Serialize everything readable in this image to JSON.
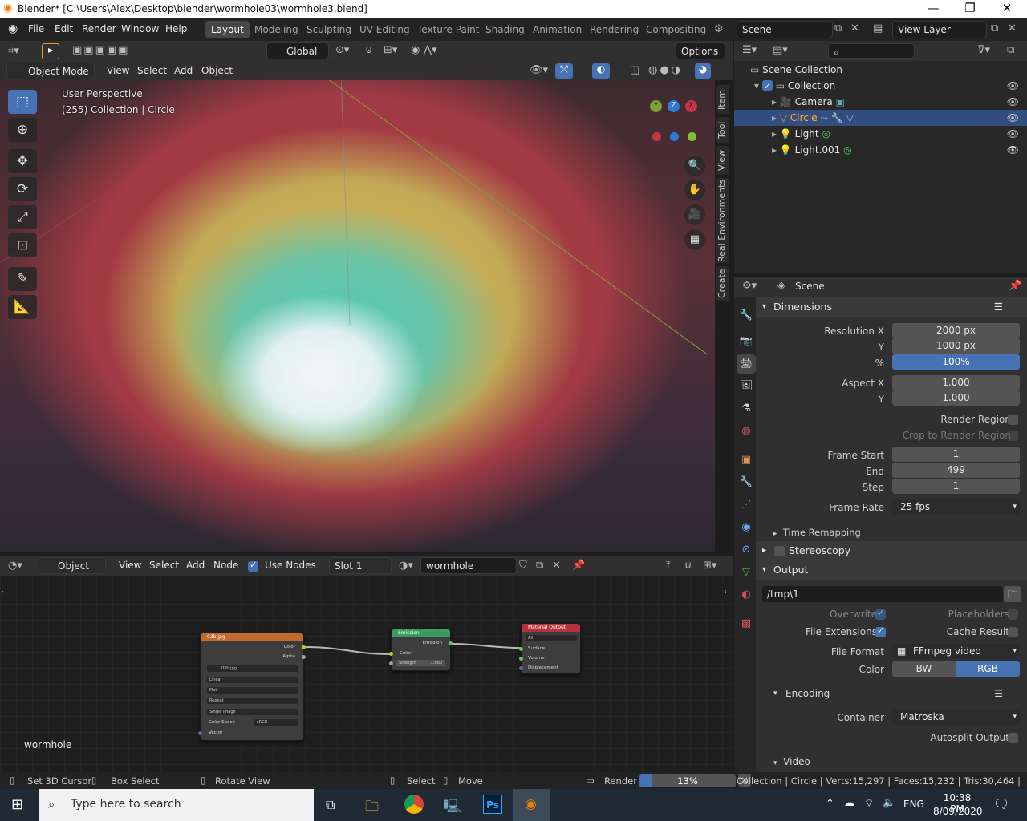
{
  "window": {
    "title": "Blender* [C:\\Users\\Alex\\Desktop\\blender\\wormhole03\\wormhole3.blend]",
    "minimize": "—",
    "restore": "❐",
    "close": "✕"
  },
  "menus": [
    "File",
    "Edit",
    "Render",
    "Window",
    "Help"
  ],
  "workspaces": [
    "Layout",
    "Modeling",
    "Sculpting",
    "UV Editing",
    "Texture Paint",
    "Shading",
    "Animation",
    "Rendering",
    "Compositing"
  ],
  "scene": {
    "scene_name": "Scene",
    "view_layer": "View Layer"
  },
  "viewport": {
    "transform_orientation": "Global",
    "options_label": "Options",
    "mode": "Object Mode",
    "header_menus": [
      "View",
      "Select",
      "Add",
      "Object"
    ],
    "hud_line1": "User Perspective",
    "hud_line2": "(255) Collection | Circle",
    "gizmo": {
      "y": "Y",
      "z": "Z",
      "x": "X"
    },
    "side_tabs": [
      "Item",
      "Tool",
      "View",
      "Real Environments",
      "Create"
    ]
  },
  "node_editor": {
    "editor_type": "Object",
    "menus": [
      "View",
      "Select",
      "Add",
      "Node"
    ],
    "use_nodes_label": "Use Nodes",
    "use_nodes": true,
    "slot": "Slot 1",
    "material": "wormhole",
    "material_label": "wormhole",
    "nodes": {
      "image": {
        "title": "03b.jpg",
        "out_color": "Color",
        "out_alpha": "Alpha",
        "image_name": "03b.jpg",
        "interp": "Linear",
        "proj": "Flat",
        "ext": "Repeat",
        "source": "Single Image",
        "colorspace_label": "Color Space",
        "colorspace": "sRGB",
        "in_vector": "Vector"
      },
      "emission": {
        "title": "Emission",
        "out": "Emission",
        "in_color": "Color",
        "strength_label": "Strength",
        "strength": "1.000"
      },
      "output": {
        "title": "Material Output",
        "target": "All",
        "in_surface": "Surface",
        "in_volume": "Volume",
        "in_displacement": "Displacement"
      }
    }
  },
  "outliner": {
    "root": "Scene Collection",
    "items": [
      {
        "name": "Collection"
      },
      {
        "name": "Camera"
      },
      {
        "name": "Circle"
      },
      {
        "name": "Light"
      },
      {
        "name": "Light.001"
      }
    ]
  },
  "properties": {
    "context": "Scene",
    "dimensions": {
      "title": "Dimensions",
      "res_x_label": "Resolution X",
      "res_x": "2000 px",
      "res_y_label": "Y",
      "res_y": "1000 px",
      "pct_label": "%",
      "pct": "100%",
      "aspect_x_label": "Aspect X",
      "aspect_x": "1.000",
      "aspect_y_label": "Y",
      "aspect_y": "1.000",
      "render_region": "Render Region",
      "crop": "Crop to Render Region",
      "frame_start_label": "Frame Start",
      "frame_start": "1",
      "end_label": "End",
      "end": "499",
      "step_label": "Step",
      "step": "1",
      "frame_rate_label": "Frame Rate",
      "frame_rate": "25 fps",
      "time_remapping": "Time Remapping"
    },
    "stereoscopy": "Stereoscopy",
    "output": {
      "title": "Output",
      "path": "/tmp\\1",
      "overwrite": "Overwrite",
      "placeholders": "Placeholders",
      "file_ext": "File Extensions",
      "cache": "Cache Result",
      "file_format_label": "File Format",
      "file_format": "FFmpeg video",
      "color_label": "Color",
      "bw": "BW",
      "rgb": "RGB"
    },
    "encoding": {
      "title": "Encoding",
      "container_label": "Container",
      "container": "Matroska",
      "autosplit": "Autosplit Output"
    },
    "video": "Video"
  },
  "status": {
    "set_cursor": "Set 3D Cursor",
    "box_select": "Box Select",
    "rotate": "Rotate View",
    "select": "Select",
    "move": "Move",
    "render_label": "Render",
    "render_progress": 0.13,
    "render_pct": "13%",
    "stats": "Collection | Circle | Verts:15,297 | Faces:15,232 | Tris:30,464 |"
  },
  "taskbar": {
    "search_placeholder": "Type here to search",
    "lang": "ENG",
    "time": "10:38 PM",
    "date": "8/09/2020"
  },
  "colors": {
    "accent": "#4772b3",
    "selected_row": "#334d80",
    "image_node": "#c06a2c",
    "emission_node": "#3a9a5f",
    "output_node": "#b3323c"
  }
}
